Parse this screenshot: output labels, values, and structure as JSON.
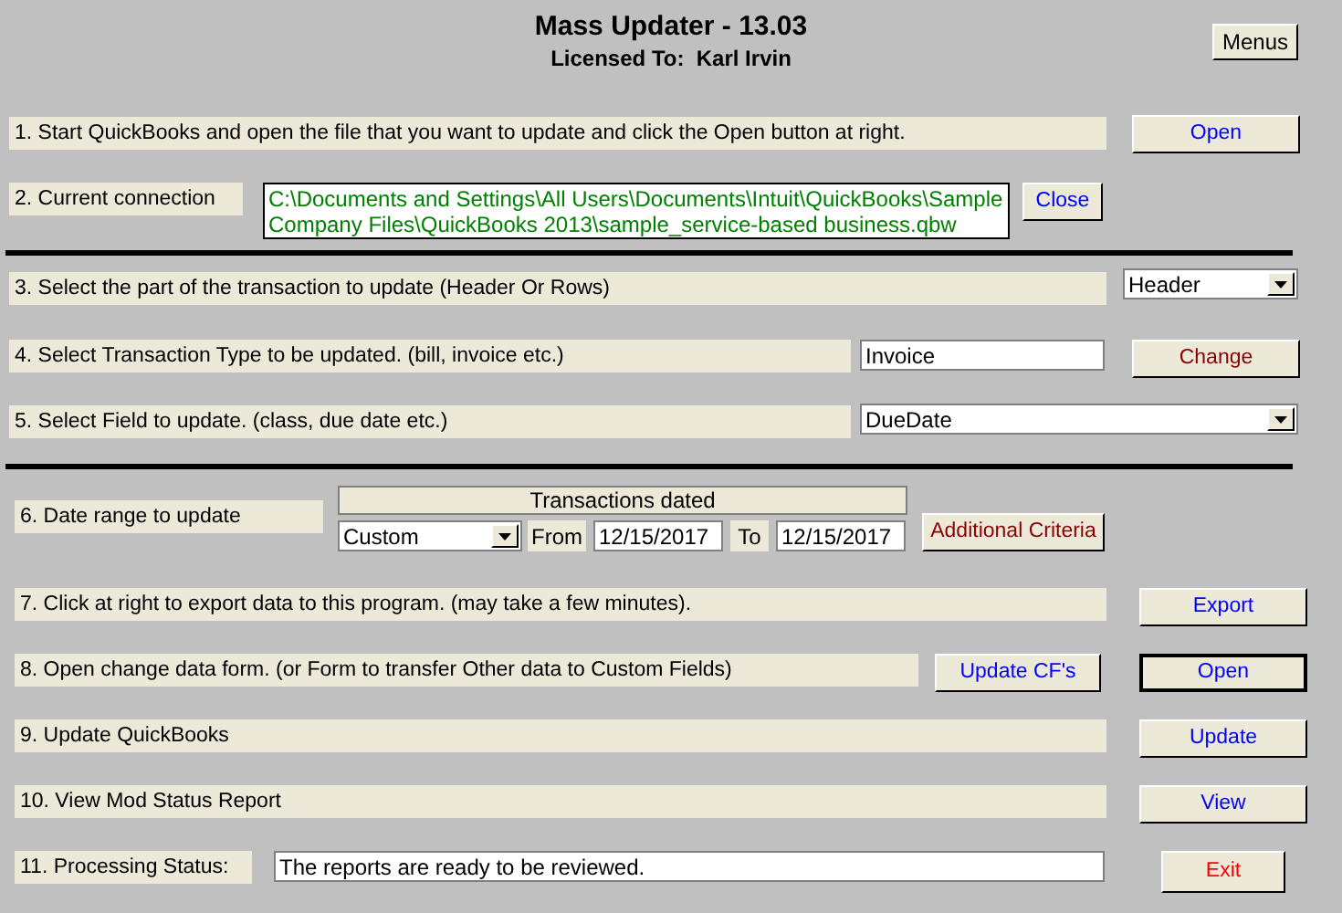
{
  "title": "Mass Updater - 13.03",
  "license": {
    "label": "Licensed To:",
    "name": "Karl Irvin"
  },
  "menu_button": {
    "label": "Menus"
  },
  "steps": [
    {
      "kind": "action",
      "label": "1. Start QuickBooks and open the file that you want to update and click the Open button at right.",
      "button": {
        "label": "Open",
        "color": "#0000ff",
        "default": false
      },
      "divider_after": false
    },
    {
      "kind": "connection",
      "label": "2. Current connection",
      "value": "C:\\Documents and Settings\\All Users\\Documents\\Intuit\\QuickBooks\\Sample Company Files\\QuickBooks 2013\\sample_service-based business.qbw",
      "button": {
        "label": "Close",
        "color": "#0000ff",
        "default": false
      },
      "divider_after": true
    },
    {
      "kind": "select",
      "label": "3. Select the part of the transaction to update (Header Or Rows)",
      "value": "Header",
      "divider_after": false
    },
    {
      "kind": "input",
      "label": "4. Select Transaction Type to be updated. (bill, invoice etc.)",
      "value": "Invoice",
      "button": {
        "label": "Change",
        "color": "#8b0000",
        "default": false
      },
      "divider_after": false
    },
    {
      "kind": "wide_select",
      "label": "5. Select Field to update. (class, due date etc.)",
      "value": "DueDate",
      "divider_after": true
    },
    {
      "kind": "date_range",
      "label": "6. Date range to update",
      "group_title": "Transactions dated",
      "range": "Custom",
      "from_label": "From",
      "from": "12/15/2017",
      "to_label": "To",
      "to": "12/15/2017",
      "button": {
        "label": "Additional Criteria",
        "color": "#8b0000",
        "default": false
      },
      "divider_after": false
    },
    {
      "kind": "action",
      "label": "7. Click at right to export data to this program. (may take a few minutes).",
      "button": {
        "label": "Export",
        "color": "#0000ff",
        "default": false
      },
      "divider_after": false
    },
    {
      "kind": "double_action",
      "label": "8. Open change data form. (or Form to transfer Other data to Custom Fields)",
      "extra_button": {
        "label": "Update CF's",
        "color": "#0000ff",
        "default": false
      },
      "button": {
        "label": "Open",
        "color": "#0000ff",
        "default": true
      },
      "divider_after": false
    },
    {
      "kind": "action",
      "label": "9. Update QuickBooks",
      "button": {
        "label": "Update",
        "color": "#0000ff",
        "default": false
      },
      "divider_after": false
    },
    {
      "kind": "action",
      "label": "10. View Mod Status Report",
      "button": {
        "label": "View",
        "color": "#0000ff",
        "default": false
      },
      "divider_after": false
    },
    {
      "kind": "status",
      "label": "11. Processing Status:",
      "value": "The reports are ready to be reviewed.",
      "button": {
        "label": "Exit",
        "color": "#ff0000",
        "default": false
      },
      "divider_after": false
    }
  ]
}
